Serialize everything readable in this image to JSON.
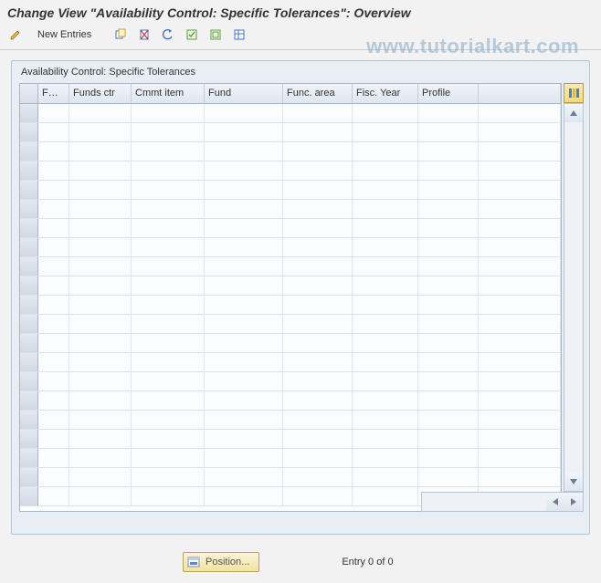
{
  "title": "Change View \"Availability Control: Specific Tolerances\": Overview",
  "watermark": "www.tutorialkart.com",
  "toolbar": {
    "new_entries_label": "New Entries",
    "icons": {
      "change": "change-display-icon",
      "copy": "copy-icon",
      "delete": "delete-icon",
      "undo": "undo-icon",
      "select_all": "select-all-icon",
      "deselect_all": "deselect-all-icon",
      "table_settings": "table-settings-icon"
    }
  },
  "panel": {
    "title": "Availability Control: Specific Tolerances"
  },
  "table": {
    "columns": [
      {
        "key": "fm",
        "label": "FM..."
      },
      {
        "key": "funds_ctr",
        "label": "Funds ctr"
      },
      {
        "key": "cmmt_item",
        "label": "Cmmt item"
      },
      {
        "key": "fund",
        "label": "Fund"
      },
      {
        "key": "func_area",
        "label": "Func. area"
      },
      {
        "key": "fisc_year",
        "label": "Fisc. Year"
      },
      {
        "key": "profile",
        "label": "Profile"
      }
    ],
    "rows": [],
    "visible_row_count": 21
  },
  "position_button": {
    "label": "Position..."
  },
  "entry_status": {
    "text": "Entry 0 of 0",
    "current": 0,
    "total": 0
  },
  "colors": {
    "panel_bg": "#e9eef4",
    "accent_button": "#f2e3a2",
    "border": "#b5c4d6"
  }
}
